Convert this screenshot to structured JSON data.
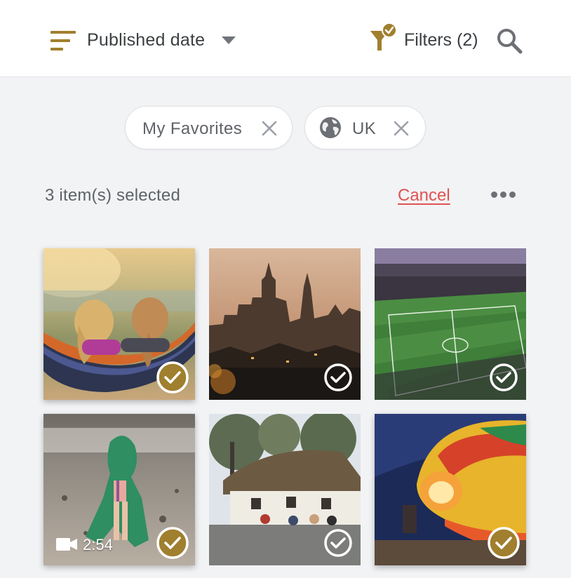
{
  "toolbar": {
    "sort_label": "Published date",
    "sort_icon": "sort-lines-icon",
    "filters_label": "Filters (2)",
    "filter_icon": "funnel-check-icon",
    "search_icon": "search-icon",
    "accent_color": "#a07f2e"
  },
  "chips": [
    {
      "label": "My Favorites",
      "icon": null,
      "remove_icon": "close-icon"
    },
    {
      "label": "UK",
      "icon": "globe-icon",
      "remove_icon": "close-icon"
    }
  ],
  "selection": {
    "status": "3 item(s) selected",
    "cancel_label": "Cancel",
    "cancel_color": "#e05252",
    "more_icon": "more-horizontal-icon"
  },
  "grid": {
    "items": [
      {
        "subject": "Two girls in hammock by lake",
        "selected": true
      },
      {
        "subject": "City skyline with clock tower at sunset",
        "selected": false
      },
      {
        "subject": "Football stadium pitch",
        "selected": false
      },
      {
        "subject": "Child in green hooded towel on beach",
        "selected": true,
        "video": true,
        "duration": "2:54"
      },
      {
        "subject": "Thatched roof village pub",
        "selected": false
      },
      {
        "subject": "Hot air balloon inflating",
        "selected": true
      }
    ]
  }
}
